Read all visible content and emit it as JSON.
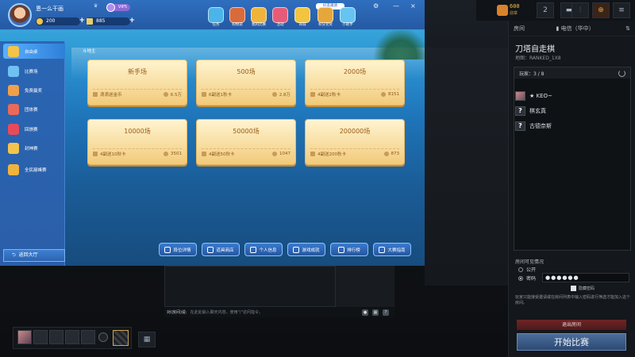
{
  "game": {
    "username": "恩一么干画",
    "level_icon": "rank-icon",
    "vip": "VIP5",
    "gold": "200",
    "coupon": "885",
    "top_icons": [
      {
        "name": "task-icon",
        "label": "任务",
        "color": "#4bb4e8"
      },
      {
        "name": "bag-icon",
        "label": "购物袋",
        "color": "#d86b3c"
      },
      {
        "name": "match-icon",
        "label": "我的比赛",
        "color": "#f0b43c"
      },
      {
        "name": "activity-icon",
        "label": "活动",
        "color": "#e65c78"
      },
      {
        "name": "shop-icon",
        "label": "商城",
        "color": "#f3c440"
      },
      {
        "name": "lottery-icon",
        "label": "积分兑奖",
        "color": "#e6a73a"
      },
      {
        "name": "helper-icon",
        "label": "小助手",
        "color": "#66c4f0"
      }
    ],
    "badge": "好友邀请",
    "window_buttons": [
      "⚙",
      "—",
      "×"
    ],
    "sidebar": [
      {
        "label": "自由桌",
        "color": "#f4c44a"
      },
      {
        "label": "比赛场",
        "color": "#6fc1f2"
      },
      {
        "label": "免费赢奖",
        "color": "#f0a04a"
      },
      {
        "label": "团体赛",
        "color": "#e86a5a"
      },
      {
        "label": "回馈赛",
        "color": "#e94a5a"
      },
      {
        "label": "封神赛",
        "color": "#f4c44a"
      },
      {
        "label": "全民巅峰赛",
        "color": "#f0b43c"
      }
    ],
    "back_label": "返回大厅",
    "breadcrumb": "斗地主",
    "rooms": [
      {
        "title": "新手场",
        "left": "滴滴送金币",
        "right": "6.5万"
      },
      {
        "title": "500场",
        "left": "6副送1秋卡",
        "right": "2.8万"
      },
      {
        "title": "2000场",
        "left": "4副送2秋卡",
        "right": "8151"
      },
      {
        "title": "10000场",
        "left": "4副送10秋卡",
        "right": "3501"
      },
      {
        "title": "50000场",
        "left": "4副送50秋卡",
        "right": "1047"
      },
      {
        "title": "200000场",
        "left": "4副送200秋卡",
        "right": "873"
      }
    ],
    "bottom_buttons": [
      "段位详情",
      "道具商店",
      "个人信息",
      "游戏成就",
      "排行榜",
      "大赛指南"
    ]
  },
  "topbar": {
    "coins": "600",
    "coins_sub": "勋章",
    "badge_num": "2"
  },
  "lobby": {
    "tab": "房间",
    "network": "电信（华中）",
    "title": "刀塔自走棋",
    "map": "地图：RANKED_1X8",
    "players_header": "玩家：3 / 8",
    "players": [
      {
        "name": "★ KEO~",
        "avatar": "img"
      },
      {
        "name": "棋玄真",
        "avatar": "?"
      },
      {
        "name": "古德奈斯",
        "avatar": "?"
      }
    ],
    "visibility_title": "房间可见情况",
    "opt_public": "公开",
    "opt_password": "密码",
    "password_value": "●●●●●●",
    "hide_password": "隐藏密码",
    "note": "玩家只能接受邀请或在房间列表中输入密码进行筛选才能加入这个房间。",
    "leave": "退出房间",
    "start": "开始比赛"
  },
  "chat": {
    "channel": "对(房间)说:",
    "placeholder": "在此处输入聊天内容。使用\"/\"访问指令。"
  }
}
